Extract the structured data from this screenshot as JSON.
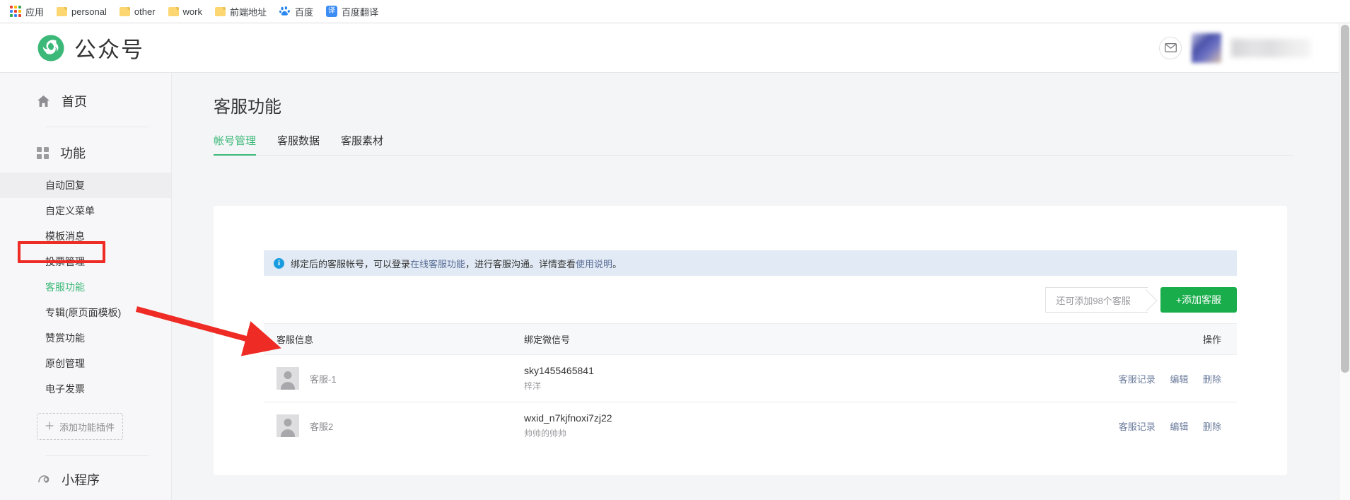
{
  "browser": {
    "bookmarks": [
      {
        "label": "应用",
        "icon": "apps-grid-icon"
      },
      {
        "label": "personal",
        "icon": "folder-icon"
      },
      {
        "label": "other",
        "icon": "folder-icon"
      },
      {
        "label": "work",
        "icon": "folder-icon"
      },
      {
        "label": "前端地址",
        "icon": "folder-icon"
      },
      {
        "label": "百度",
        "icon": "baidu-icon"
      },
      {
        "label": "百度翻译",
        "icon": "translate-icon"
      }
    ],
    "translate_icon_glyph": "译"
  },
  "header": {
    "brand": "公众号",
    "logo_icon": "wechat-mp-logo-icon",
    "mail_icon": "envelope-icon",
    "avatar": "user-avatar-blurred",
    "username": "（已打码）"
  },
  "sidebar": {
    "home": {
      "label": "首页",
      "icon": "home-icon"
    },
    "features": {
      "label": "功能",
      "icon": "grid-icon"
    },
    "items": [
      {
        "label": "自动回复",
        "state": "hovered"
      },
      {
        "label": "自定义菜单",
        "state": "normal"
      },
      {
        "label": "模板消息",
        "state": "normal"
      },
      {
        "label": "投票管理",
        "state": "normal"
      },
      {
        "label": "客服功能",
        "state": "active"
      },
      {
        "label": "专辑(原页面模板)",
        "state": "normal"
      },
      {
        "label": "赞赏功能",
        "state": "normal"
      },
      {
        "label": "原创管理",
        "state": "normal"
      },
      {
        "label": "电子发票",
        "state": "normal"
      }
    ],
    "add_plugin": {
      "label": "添加功能插件",
      "icon": "plus-icon"
    },
    "miniprogram": {
      "label": "小程序",
      "icon": "miniprogram-icon"
    }
  },
  "main": {
    "title": "客服功能",
    "tabs": [
      {
        "label": "帐号管理",
        "active": true
      },
      {
        "label": "客服数据",
        "active": false
      },
      {
        "label": "客服素材",
        "active": false
      }
    ],
    "notice": {
      "icon": "info-icon",
      "glyph": "i",
      "part1": "绑定后的客服帐号，可以登录",
      "link1": "在线客服功能",
      "part2": "，进行客服沟通。详情查看",
      "link2": "使用说明",
      "part3": "。"
    },
    "quota_button": "还可添加98个客服",
    "add_button": "+添加客服",
    "table": {
      "headers": [
        "客服信息",
        "绑定微信号",
        "操作"
      ],
      "rows": [
        {
          "avatar": "default-avatar-icon",
          "name": "客服-1",
          "wxid": "sky1455465841",
          "nickname": "梓洋",
          "actions": [
            "客服记录",
            "编辑",
            "删除"
          ]
        },
        {
          "avatar": "default-avatar-icon",
          "name": "客服2",
          "wxid": "wxid_n7kjfnoxi7zj22",
          "nickname": "帅帅的帅帅",
          "actions": [
            "客服记录",
            "编辑",
            "删除"
          ]
        }
      ]
    }
  },
  "annotations": {
    "highlight_target": "客服功能",
    "arrow_color": "#ee2b24"
  },
  "colors": {
    "brand_green": "#1aad4b",
    "accent_green": "#3bb978",
    "link_blue": "#576b95",
    "notice_bg": "#e2ebf5",
    "annotation_red": "#ee2b24"
  }
}
